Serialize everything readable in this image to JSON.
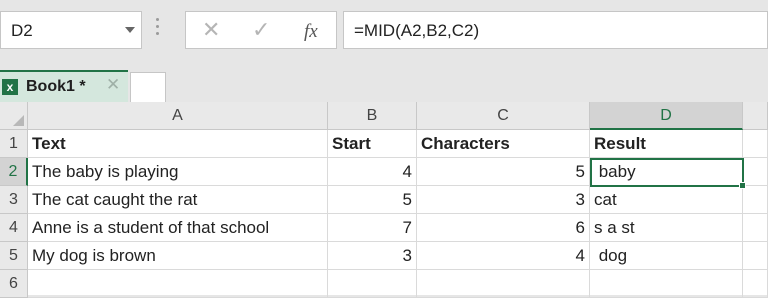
{
  "name_box": {
    "value": "D2"
  },
  "formula_bar": {
    "cancel_icon": "close-icon",
    "enter_icon": "check-icon",
    "fx_label": "fx",
    "formula": "=MID(A2,B2,C2)"
  },
  "workbook_tab": {
    "label": "Book1 *",
    "icon": "excel-icon"
  },
  "columns": [
    "A",
    "B",
    "C",
    "D"
  ],
  "rows": [
    "1",
    "2",
    "3",
    "4",
    "5",
    "6"
  ],
  "cells": [
    [
      "Text",
      "Start",
      "Characters",
      "Result"
    ],
    [
      "The baby is playing",
      "4",
      "5",
      " baby"
    ],
    [
      "The cat caught the rat",
      "5",
      "3",
      "cat"
    ],
    [
      "Anne is a student of that school",
      "7",
      "6",
      "s a st"
    ],
    [
      "My dog is brown",
      "3",
      "4",
      " dog"
    ],
    [
      "",
      "",
      "",
      ""
    ]
  ],
  "selection": {
    "cell": "D2",
    "accent_color": "#217346"
  }
}
